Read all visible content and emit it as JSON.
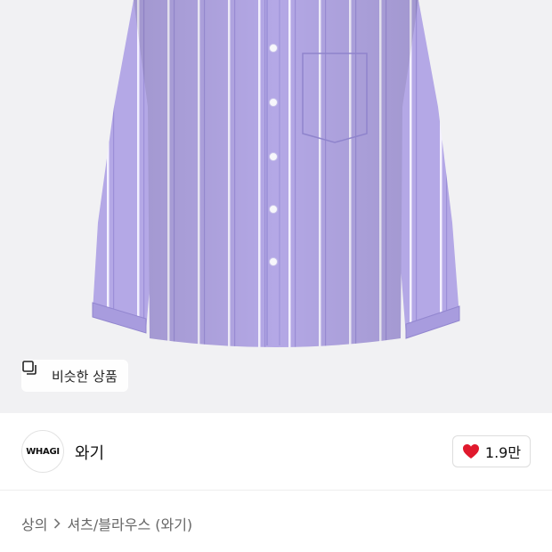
{
  "product_image": {
    "description_icon": "striped-shirt-image"
  },
  "similar_button": {
    "icon": "similar-items-icon",
    "label": "비슷한 상품"
  },
  "brand": {
    "logo_text": "WHAGI",
    "name": "와기"
  },
  "like": {
    "icon": "heart-icon",
    "count": "1.9만",
    "color": "#e0192d"
  },
  "breadcrumb": {
    "items": [
      "상의",
      "셔츠/블라우스 (와기)"
    ],
    "separator_icon": "chevron-right-icon"
  },
  "product_title": {
    "text": ""
  }
}
